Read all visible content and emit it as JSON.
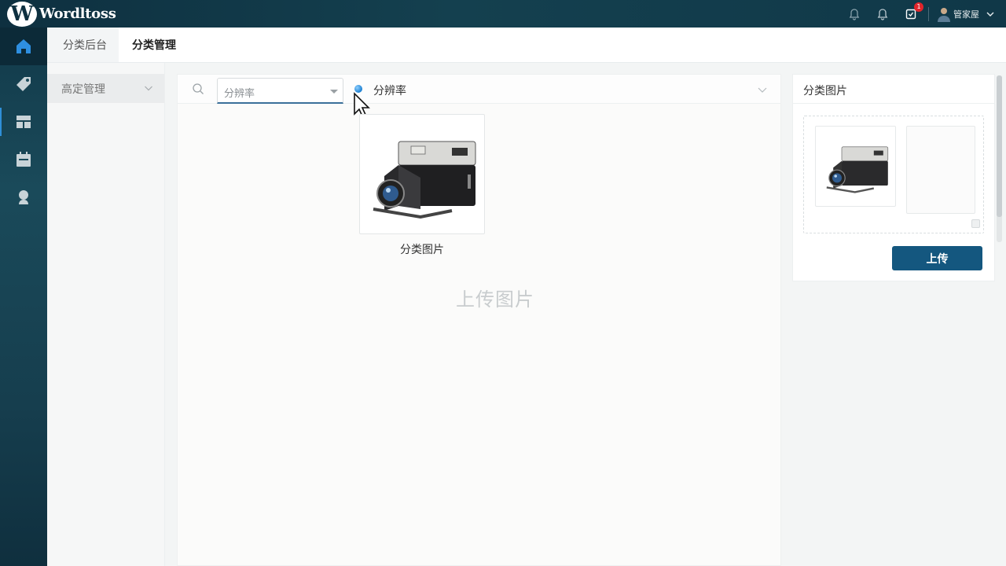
{
  "app": {
    "logo_letter": "W",
    "brand_name": "Wordltoss"
  },
  "header": {
    "notification_badge": "1",
    "user_name": "管家屋"
  },
  "rail": {
    "items": [
      "home-icon",
      "tag-icon",
      "dashboard-icon",
      "calendar-icon",
      "user-icon"
    ]
  },
  "breadcrumb": {
    "parent": "分类后台",
    "current": "分类管理"
  },
  "subnav": {
    "item_label": "高定管理"
  },
  "main": {
    "resolution_select_value": "分辨率",
    "resolution_label": "分辨率",
    "thumbnail_caption": "分类图片",
    "upload_hint": "上传图片"
  },
  "right_panel": {
    "title": "分类图片",
    "upload_button": "上传"
  },
  "colors": {
    "topbar": "#0e3040",
    "primary_button": "#14577f",
    "badge": "#e0252b",
    "accent_dot": "#1b7fd1"
  }
}
